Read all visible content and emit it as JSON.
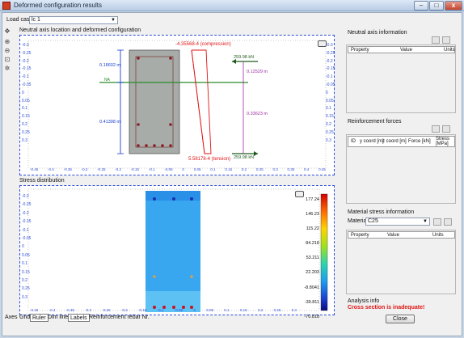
{
  "window": {
    "title": "Deformed configuration results",
    "minimize": "–",
    "maximize": "□",
    "close": "x"
  },
  "load_case": {
    "label": "Load case",
    "value": "lc 1"
  },
  "neutral_axis_plot": {
    "title": "Neutral axis location and deformed configuration",
    "ticks_left": [
      "-0.3",
      "-0.25",
      "-0.2",
      "-0.15",
      "-0.1",
      "-0.05",
      "0",
      "0.05",
      "0.1",
      "0.15",
      "0.2",
      "0.25",
      "0.3"
    ],
    "ticks_bottom": [
      "-0.45",
      "-0.4",
      "-0.35",
      "-0.3",
      "-0.25",
      "-0.2",
      "-0.15",
      "-0.1",
      "-0.05",
      "0",
      "0.05",
      "0.1",
      "0.15",
      "0.2",
      "0.25",
      "0.3",
      "0.35",
      "0.4",
      "0.45"
    ],
    "compression_label": "-4.35568-4 (compression)",
    "tension_label": "5.58178-4 (tension)",
    "dim_top": "0.18602 m",
    "dim_bottom": "0.41398 m",
    "na_label": "NA",
    "force_top": "259.98 kN",
    "force_bottom": "259.98 kN",
    "lever_top": "0.12529 m",
    "lever_bottom": "0.33623 m"
  },
  "stress_plot": {
    "title": "Stress distribution",
    "legend_values": [
      "177.24",
      "146.23",
      "115.22",
      "84.218",
      "53.211",
      "22.203",
      "-8.8041",
      "-39.811",
      "-70.818"
    ]
  },
  "neutral_axis_info": {
    "title": "Neutral axis information",
    "columns": [
      "Property",
      "Value",
      "Units"
    ]
  },
  "reinforcement_forces": {
    "title": "Reinforcement forces",
    "columns": [
      "ID",
      "y coord [m]",
      "z coord [m]",
      "Force [kN]",
      "Stress [MPa]"
    ]
  },
  "material_stress": {
    "title": "Material stress information",
    "material_label": "Material",
    "material_value": "C25",
    "columns": [
      "Property",
      "Value",
      "Units"
    ]
  },
  "analysis_info": {
    "title": "Analysis info",
    "message": "Cross section is inadequate!"
  },
  "bottom_tabs": [
    "Axes",
    "Grid",
    "Ruler",
    "Dim lines",
    "Labels",
    "Reinforcement rebar Nr."
  ],
  "close_button": "Close",
  "colors": {
    "section_fill": "#a8aca8",
    "neutral_axis": "#2a8a2a",
    "strain_line": "#e01414",
    "dimension": "#1a3fd0",
    "lever": "#9a2aa0",
    "rebar": "#8b1e2a",
    "stress_fill": "#39a6f0"
  }
}
